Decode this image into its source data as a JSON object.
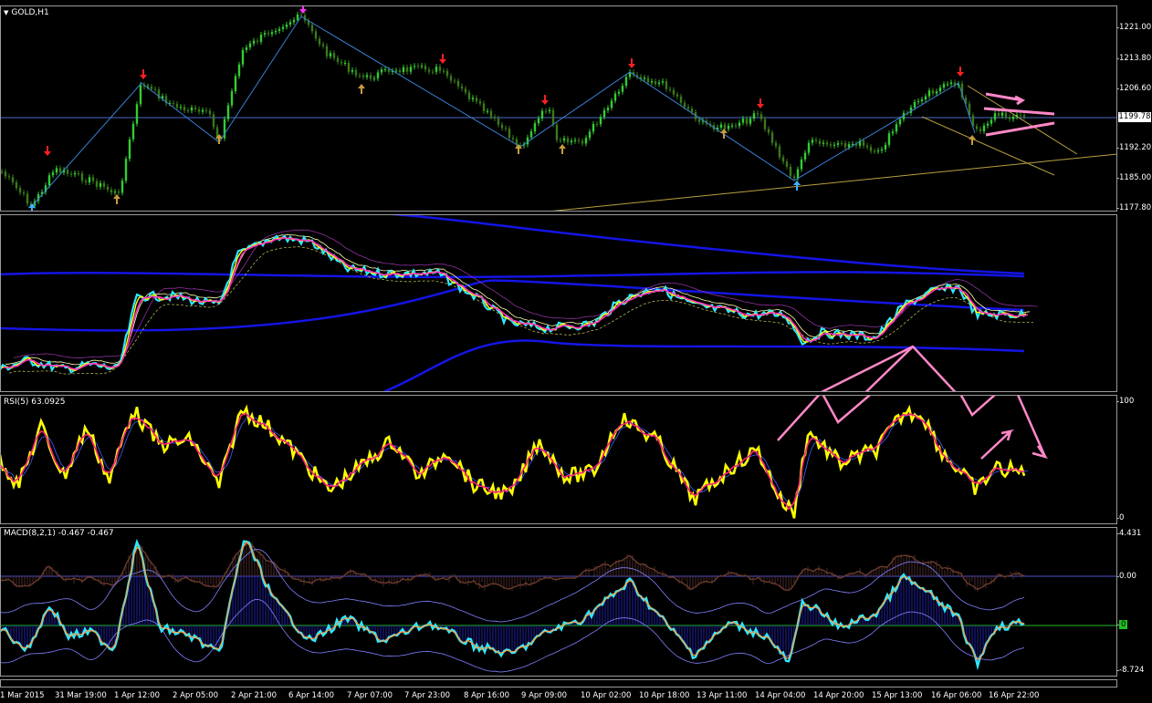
{
  "main": {
    "title": "GOLD,H1",
    "price_ticks": [
      "1221.00",
      "1213.80",
      "1206.60",
      "1199.78",
      "1192.20",
      "1185.00",
      "1177.80"
    ],
    "current_price": "1199.78"
  },
  "rsi": {
    "label": "RSI(5) 63.0925",
    "ticks": [
      "100",
      "0"
    ]
  },
  "macd": {
    "label": "MACD(8,2,1) -0.467 -0.467",
    "ticks": [
      "4.431",
      "0.00",
      "0",
      "-8.724"
    ]
  },
  "time_labels": [
    "1 Mar 2015",
    "31 Mar 19:00",
    "1 Apr 12:00",
    "2 Apr 05:00",
    "2 Apr 21:00",
    "6 Apr 14:00",
    "7 Apr 07:00",
    "7 Apr 23:00",
    "8 Apr 16:00",
    "9 Apr 09:00",
    "10 Apr 02:00",
    "10 Apr 18:00",
    "13 Apr 11:00",
    "14 Apr 04:00",
    "14 Apr 20:00",
    "15 Apr 13:00",
    "16 Apr 06:00",
    "16 Apr 22:00"
  ],
  "colors": {
    "up_candle": "#32cd32",
    "down_candle": "#3a7a1a",
    "zigzag": "#3a7fd5",
    "trend": "#b8a040",
    "pink_annotation": "#ff88c8",
    "band_blue": "#1414e6",
    "rsi_yellow": "#ffff00",
    "rsi_red": "#ff2080",
    "macd_cyan": "#2ee8ff",
    "macd_histogram": "#2020a8",
    "zero_green": "#22c022"
  },
  "icons": [
    "sell-arrow-icon",
    "buy-arrow-icon",
    "dropdown-triangle-icon"
  ]
}
